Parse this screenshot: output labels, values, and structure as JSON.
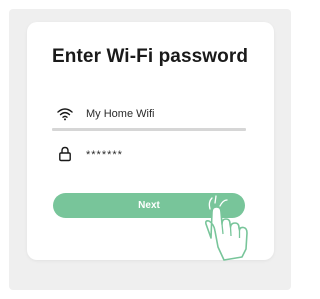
{
  "dialog": {
    "title": "Enter Wi-Fi password",
    "network": {
      "icon": "wifi-icon",
      "name": "My Home Wifi"
    },
    "password": {
      "icon": "lock-icon",
      "masked_value": "*******"
    },
    "next_button": {
      "label": "Next",
      "color": "#78c59a"
    },
    "pointer": {
      "icon": "tap-hand-icon"
    }
  }
}
